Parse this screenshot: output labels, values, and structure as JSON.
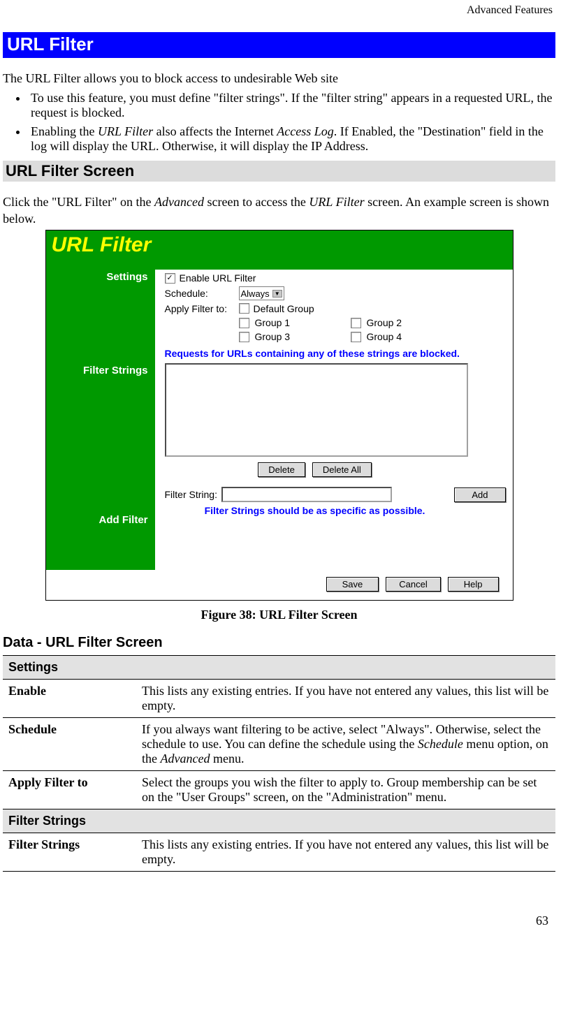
{
  "header": {
    "right": "Advanced Features"
  },
  "title": "URL Filter",
  "intro": "The URL Filter allows you to block access to undesirable Web site",
  "bullets": [
    {
      "pre": "To use this feature, you must define \"filter strings\". If the \"filter string\" appears in a requested URL, the request is blocked."
    },
    {
      "b2_p1": "Enabling the ",
      "b2_i1": "URL Filter",
      "b2_p2": " also affects the Internet ",
      "b2_i2": "Access Log",
      "b2_p3": ". If Enabled, the \"Destination\" field in the log will display the URL. Otherwise, it will display the IP Address."
    }
  ],
  "section_heading": "URL Filter Screen",
  "click_p1": "Click the \"URL Filter\" on the ",
  "click_i1": "Advanced",
  "click_p2": " screen to access the ",
  "click_i2": "URL Filter",
  "click_p3": " screen. An example screen is shown below.",
  "screenshot": {
    "title": "URL Filter",
    "sidebar": {
      "settings": "Settings",
      "filter_strings": "Filter Strings",
      "add_filter": "Add Filter"
    },
    "settings": {
      "enable_label": "Enable URL Filter",
      "schedule_label": "Schedule:",
      "schedule_value": "Always",
      "apply_label": "Apply Filter to:",
      "default_group": "Default Group",
      "groups": [
        "Group 1",
        "Group 2",
        "Group 3",
        "Group 4"
      ]
    },
    "filter": {
      "note": "Requests for URLs containing any of these strings are blocked.",
      "delete": "Delete",
      "delete_all": "Delete All"
    },
    "add": {
      "label": "Filter String:",
      "add_btn": "Add",
      "note": "Filter Strings should be as specific as possible."
    },
    "bottom": {
      "save": "Save",
      "cancel": "Cancel",
      "help": "Help"
    }
  },
  "figure_caption": "Figure 38: URL Filter Screen",
  "data_heading": "Data - URL Filter Screen",
  "table": {
    "sec_settings": "Settings",
    "row_enable_label": "Enable",
    "row_enable_text": "This lists any existing entries. If you have not entered any values, this list will be empty.",
    "row_schedule_label": "Schedule",
    "row_schedule_p1": "If you always want filtering to be active, select \"Always\". Otherwise, select the schedule to use. You can define the schedule using the ",
    "row_schedule_i1": "Schedule",
    "row_schedule_p2": " menu option, on the ",
    "row_schedule_i2": "Advanced",
    "row_schedule_p3": " menu.",
    "row_apply_label": "Apply Filter to",
    "row_apply_text": "Select the groups you wish the filter to apply to. Group membership can be set on the \"User Groups\" screen, on the \"Administration\" menu.",
    "sec_filter": "Filter Strings",
    "row_fs_label": "Filter Strings",
    "row_fs_text": "This lists any existing entries. If you have not entered any values, this list will be empty."
  },
  "page_number": "63"
}
